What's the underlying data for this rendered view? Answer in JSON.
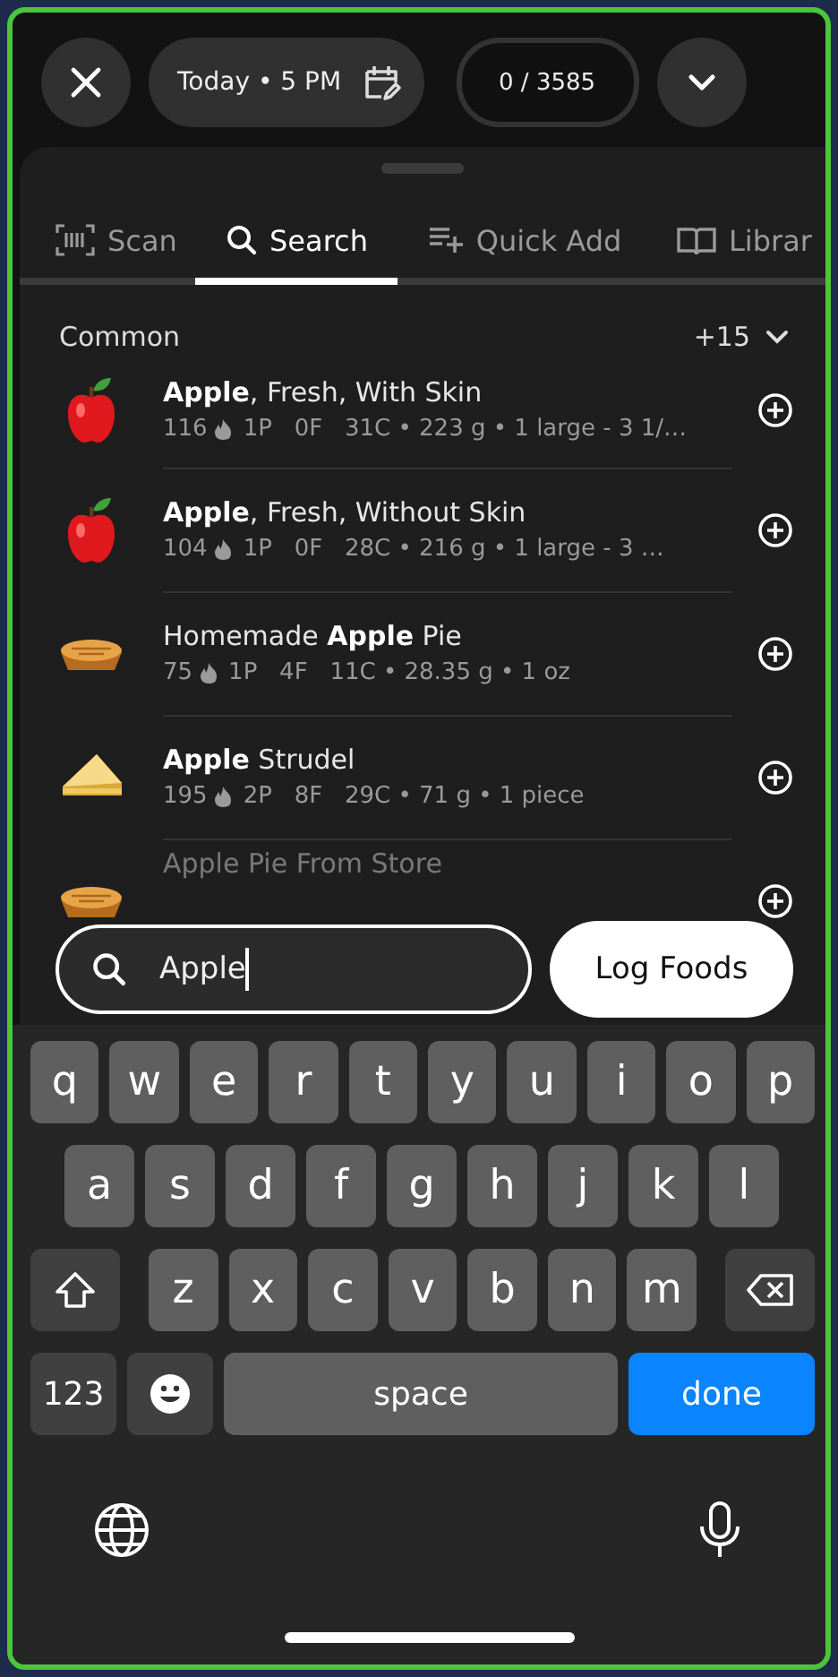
{
  "top_bar": {
    "date": "Today • 5 PM",
    "counter": "0 / 3585"
  },
  "tabs": [
    {
      "label": "Scan",
      "kind": "barcode",
      "selected": false
    },
    {
      "label": "Search",
      "kind": "search",
      "selected": true
    },
    {
      "label": "Quick Add",
      "kind": "list-add",
      "selected": false
    },
    {
      "label": "Librar",
      "kind": "book",
      "selected": false
    }
  ],
  "section": {
    "title": "Common",
    "count": "+15"
  },
  "foods": [
    {
      "kind": "apple",
      "name": "**Apple**, Fresh, With Skin",
      "calories": "116",
      "details": "1P   0F   31C • 223 g • 1 large - 3 1/…"
    },
    {
      "kind": "apple",
      "name": "**Apple**, Fresh, Without Skin",
      "calories": "104",
      "details": "1P   0F   28C • 216 g • 1 large - 3 …"
    },
    {
      "kind": "pie",
      "name": "Homemade **Apple** Pie",
      "calories": "75",
      "details": "1P   4F   11C • 28.35 g • 1 oz"
    },
    {
      "kind": "strudel",
      "name": "**Apple** Strudel",
      "calories": "195",
      "details": "2P   8F   29C • 71 g • 1 piece"
    },
    {
      "kind": "pie",
      "name": "Apple Pie From Store"
    }
  ],
  "search": {
    "value": "Apple"
  },
  "log_button": "Log Foods",
  "keyboard": {
    "rows": [
      [
        "q",
        "w",
        "e",
        "r",
        "t",
        "y",
        "u",
        "i",
        "o",
        "p"
      ],
      [
        "a",
        "s",
        "d",
        "f",
        "g",
        "h",
        "j",
        "k",
        "l"
      ],
      [
        "z",
        "x",
        "c",
        "v",
        "b",
        "n",
        "m"
      ]
    ],
    "numbers_key": "123",
    "space_key": "space",
    "done_key": "done"
  }
}
